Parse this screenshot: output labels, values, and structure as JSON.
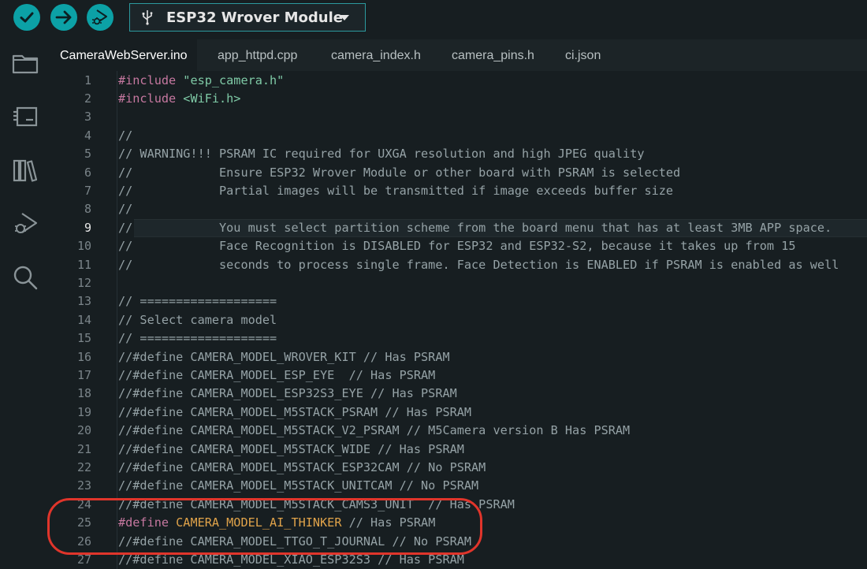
{
  "toolbar": {
    "verify_icon": "check-icon",
    "upload_icon": "arrow-right-icon",
    "debug_icon": "debug-icon",
    "board_name": "ESP32 Wrover Module",
    "usb_icon": "usb-icon",
    "dropdown_icon": "caret-down-icon"
  },
  "sidebar": {
    "items": [
      {
        "icon": "folder-icon"
      },
      {
        "icon": "board-manager-icon"
      },
      {
        "icon": "library-icon"
      },
      {
        "icon": "debug-run-icon"
      },
      {
        "icon": "search-icon"
      }
    ]
  },
  "tabs": [
    {
      "label": "CameraWebServer.ino",
      "active": true
    },
    {
      "label": "app_httpd.cpp",
      "active": false
    },
    {
      "label": "camera_index.h",
      "active": false
    },
    {
      "label": "camera_pins.h",
      "active": false
    },
    {
      "label": "ci.json",
      "active": false
    }
  ],
  "editor": {
    "current_line": 9,
    "lines": [
      {
        "n": "1",
        "t": [
          [
            "pre",
            "#include "
          ],
          [
            "str",
            "\"esp_camera.h\""
          ]
        ]
      },
      {
        "n": "2",
        "t": [
          [
            "pre",
            "#include "
          ],
          [
            "str",
            "<WiFi.h>"
          ]
        ]
      },
      {
        "n": "3",
        "t": []
      },
      {
        "n": "4",
        "t": [
          [
            "comment",
            "//"
          ]
        ]
      },
      {
        "n": "5",
        "t": [
          [
            "comment",
            "// WARNING!!! PSRAM IC required for UXGA resolution and high JPEG quality"
          ]
        ]
      },
      {
        "n": "6",
        "t": [
          [
            "comment",
            "//            Ensure ESP32 Wrover Module or other board with PSRAM is selected"
          ]
        ]
      },
      {
        "n": "7",
        "t": [
          [
            "comment",
            "//            Partial images will be transmitted if image exceeds buffer size"
          ]
        ]
      },
      {
        "n": "8",
        "t": [
          [
            "comment",
            "//"
          ]
        ]
      },
      {
        "n": "9",
        "t": [
          [
            "comment",
            "//            You must select partition scheme from the board menu that has at least 3MB APP space."
          ]
        ]
      },
      {
        "n": "10",
        "t": [
          [
            "comment",
            "//            Face Recognition is DISABLED for ESP32 and ESP32-S2, because it takes up from 15"
          ]
        ]
      },
      {
        "n": "11",
        "t": [
          [
            "comment",
            "//            seconds to process single frame. Face Detection is ENABLED if PSRAM is enabled as well"
          ]
        ]
      },
      {
        "n": "12",
        "t": []
      },
      {
        "n": "13",
        "t": [
          [
            "comment",
            "// ==================="
          ]
        ]
      },
      {
        "n": "14",
        "t": [
          [
            "comment",
            "// Select camera model"
          ]
        ]
      },
      {
        "n": "15",
        "t": [
          [
            "comment",
            "// ==================="
          ]
        ]
      },
      {
        "n": "16",
        "t": [
          [
            "comment",
            "//#define CAMERA_MODEL_WROVER_KIT // Has PSRAM"
          ]
        ]
      },
      {
        "n": "17",
        "t": [
          [
            "comment",
            "//#define CAMERA_MODEL_ESP_EYE  // Has PSRAM"
          ]
        ]
      },
      {
        "n": "18",
        "t": [
          [
            "comment",
            "//#define CAMERA_MODEL_ESP32S3_EYE // Has PSRAM"
          ]
        ]
      },
      {
        "n": "19",
        "t": [
          [
            "comment",
            "//#define CAMERA_MODEL_M5STACK_PSRAM // Has PSRAM"
          ]
        ]
      },
      {
        "n": "20",
        "t": [
          [
            "comment",
            "//#define CAMERA_MODEL_M5STACK_V2_PSRAM // M5Camera version B Has PSRAM"
          ]
        ]
      },
      {
        "n": "21",
        "t": [
          [
            "comment",
            "//#define CAMERA_MODEL_M5STACK_WIDE // Has PSRAM"
          ]
        ]
      },
      {
        "n": "22",
        "t": [
          [
            "comment",
            "//#define CAMERA_MODEL_M5STACK_ESP32CAM // No PSRAM"
          ]
        ]
      },
      {
        "n": "23",
        "t": [
          [
            "comment",
            "//#define CAMERA_MODEL_M5STACK_UNITCAM // No PSRAM"
          ]
        ]
      },
      {
        "n": "24",
        "t": [
          [
            "comment",
            "//#define CAMERA_MODEL_M5STACK_CAMS3_UNIT  // Has PSRAM"
          ]
        ]
      },
      {
        "n": "25",
        "t": [
          [
            "pre",
            "#define "
          ],
          [
            "name",
            "CAMERA_MODEL_AI_THINKER"
          ],
          [
            "comment",
            " // Has PSRAM"
          ]
        ]
      },
      {
        "n": "26",
        "t": [
          [
            "comment",
            "//#define CAMERA_MODEL_TTGO_T_JOURNAL // No PSRAM"
          ]
        ]
      },
      {
        "n": "27",
        "t": [
          [
            "comment",
            "//#define CAMERA_MODEL_XIAO_ESP32S3 // Has PSRAM"
          ]
        ]
      }
    ]
  },
  "colors": {
    "accent": "#0ca1a6",
    "annotation": "#e0352b",
    "background": "#171e21"
  }
}
